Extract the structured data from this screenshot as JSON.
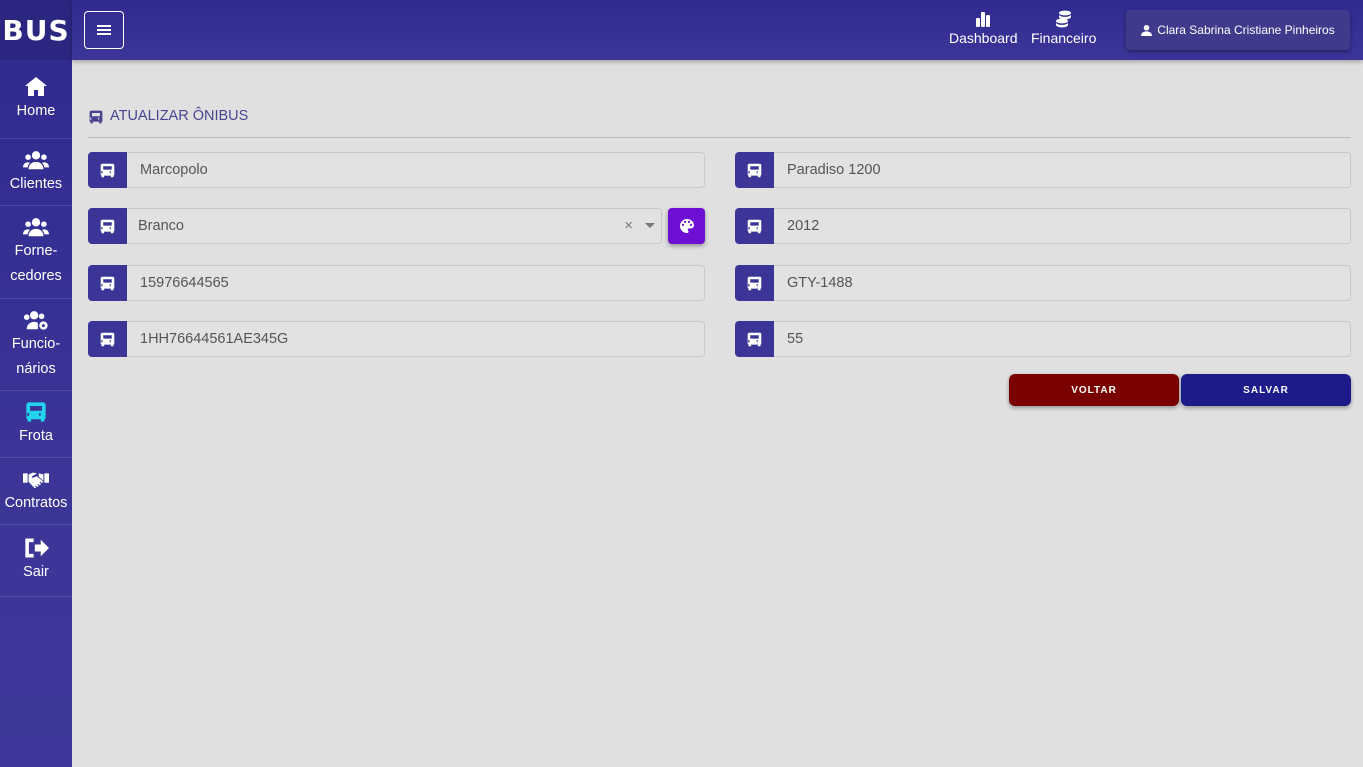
{
  "brand": "BUS",
  "sidebar": {
    "items": [
      {
        "label": "Home",
        "icon": "home-icon"
      },
      {
        "label": "Clientes",
        "icon": "users-icon"
      },
      {
        "label_line1": "Forne-",
        "label_line2": "cedores",
        "icon": "users-icon"
      },
      {
        "label_line1": "Funcio-",
        "label_line2": "nários",
        "icon": "users-cog-icon"
      },
      {
        "label": "Frota",
        "icon": "bus-icon",
        "active": true
      },
      {
        "label": "Contratos",
        "icon": "handshake-icon"
      },
      {
        "label": "Sair",
        "icon": "sign-out-icon"
      }
    ]
  },
  "topbar": {
    "dashboard": "Dashboard",
    "financeiro": "Financeiro",
    "user": "Clara Sabrina Cristiane Pinheiros"
  },
  "section_title": "ATUALIZAR ÔNIBUS",
  "form": {
    "marca": "Marcopolo",
    "modelo": "Paradiso 1200",
    "cor": "Branco",
    "ano": "2012",
    "renavam": "15976644565",
    "placa": "GTY-1488",
    "chassi": "1HH76644561AE345G",
    "capacidade": "55"
  },
  "buttons": {
    "back": "VOLTAR",
    "save": "SALVAR"
  },
  "colors": {
    "primary": "#3b3597",
    "active_icon": "#22d3ee",
    "palette_button": "#6d10d4",
    "back_button": "#7a0000",
    "save_button": "#1d1b8a"
  }
}
